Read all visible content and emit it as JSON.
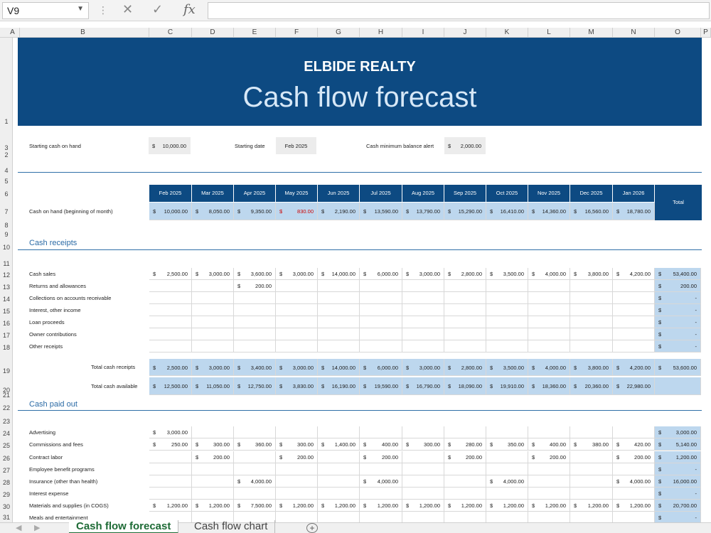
{
  "formula_bar": {
    "name_box": "V9",
    "cancel_icon": "✕",
    "enter_icon": "✓",
    "fx": "fx",
    "formula": ""
  },
  "columns": [
    "A",
    "B",
    "C",
    "D",
    "E",
    "F",
    "G",
    "H",
    "I",
    "J",
    "K",
    "L",
    "M",
    "N",
    "O",
    "P"
  ],
  "rows": [
    "1",
    "2",
    "3",
    "4",
    "5",
    "6",
    "7",
    "8",
    "9",
    "10",
    "11",
    "12",
    "13",
    "14",
    "15",
    "16",
    "17",
    "18",
    "19",
    "20",
    "21",
    "22",
    "23",
    "24",
    "25",
    "26",
    "27",
    "28",
    "29",
    "30",
    "31"
  ],
  "banner": {
    "company": "ELBIDE REALTY",
    "title": "Cash flow forecast",
    "color": "#0d4a82"
  },
  "inputs": {
    "starting_cash_label": "Starting cash on hand",
    "starting_cash_currency": "$",
    "starting_cash_value": "10,000.00",
    "starting_date_label": "Starting date",
    "starting_date_value": "Feb 2025",
    "min_balance_label": "Cash minimum balance alert",
    "min_balance_currency": "$",
    "min_balance_value": "2,000.00"
  },
  "months": [
    "Feb 2025",
    "Mar 2025",
    "Apr 2025",
    "May 2025",
    "Jun 2025",
    "Jul 2025",
    "Aug 2025",
    "Sep 2025",
    "Oct 2025",
    "Nov 2025",
    "Dec 2025",
    "Jan 2026"
  ],
  "total_label": "Total",
  "cash_on_hand": {
    "label": "Cash on hand (beginning of month)",
    "values": [
      "10,000.00",
      "8,050.00",
      "9,350.00",
      "830.00",
      "2,190.00",
      "13,590.00",
      "13,790.00",
      "15,290.00",
      "16,410.00",
      "14,360.00",
      "16,560.00",
      "18,780.00"
    ],
    "negative_index": 3
  },
  "receipts": {
    "section_title": "Cash receipts",
    "rows": [
      {
        "label": "Cash sales",
        "values": [
          "2,500.00",
          "3,000.00",
          "3,600.00",
          "3,000.00",
          "14,000.00",
          "6,000.00",
          "3,000.00",
          "2,800.00",
          "3,500.00",
          "4,000.00",
          "3,800.00",
          "4,200.00"
        ],
        "total": "53,400.00"
      },
      {
        "label": "Returns and allowances",
        "values": [
          "",
          "",
          "200.00",
          "",
          "",
          "",
          "",
          "",
          "",
          "",
          "",
          ""
        ],
        "total": "200.00"
      },
      {
        "label": "Collections on accounts receivable",
        "values": [
          "",
          "",
          "",
          "",
          "",
          "",
          "",
          "",
          "",
          "",
          "",
          ""
        ],
        "total": "-"
      },
      {
        "label": "Interest, other income",
        "values": [
          "",
          "",
          "",
          "",
          "",
          "",
          "",
          "",
          "",
          "",
          "",
          ""
        ],
        "total": "-"
      },
      {
        "label": "Loan proceeds",
        "values": [
          "",
          "",
          "",
          "",
          "",
          "",
          "",
          "",
          "",
          "",
          "",
          ""
        ],
        "total": "-"
      },
      {
        "label": "Owner contributions",
        "values": [
          "",
          "",
          "",
          "",
          "",
          "",
          "",
          "",
          "",
          "",
          "",
          ""
        ],
        "total": "-"
      },
      {
        "label": "Other receipts",
        "values": [
          "",
          "",
          "",
          "",
          "",
          "",
          "",
          "",
          "",
          "",
          "",
          ""
        ],
        "total": "-"
      }
    ],
    "total_row": {
      "label": "Total cash receipts",
      "values": [
        "2,500.00",
        "3,000.00",
        "3,400.00",
        "3,000.00",
        "14,000.00",
        "6,000.00",
        "3,000.00",
        "2,800.00",
        "3,500.00",
        "4,000.00",
        "3,800.00",
        "4,200.00"
      ],
      "total": "53,600.00"
    },
    "available_row": {
      "label": "Total cash available",
      "values": [
        "12,500.00",
        "11,050.00",
        "12,750.00",
        "3,830.00",
        "16,190.00",
        "19,590.00",
        "16,790.00",
        "18,090.00",
        "19,910.00",
        "18,360.00",
        "20,360.00",
        "22,980.00"
      ],
      "total": ""
    }
  },
  "paid_out": {
    "section_title": "Cash paid out",
    "rows": [
      {
        "label": "Advertising",
        "values": [
          "3,000.00",
          "",
          "",
          "",
          "",
          "",
          "",
          "",
          "",
          "",
          "",
          ""
        ],
        "total": "3,000.00"
      },
      {
        "label": "Commissions and fees",
        "values": [
          "250.00",
          "300.00",
          "360.00",
          "300.00",
          "1,400.00",
          "400.00",
          "300.00",
          "280.00",
          "350.00",
          "400.00",
          "380.00",
          "420.00"
        ],
        "total": "5,140.00"
      },
      {
        "label": "Contract labor",
        "values": [
          "",
          "200.00",
          "",
          "200.00",
          "",
          "200.00",
          "",
          "200.00",
          "",
          "200.00",
          "",
          "200.00"
        ],
        "total": "1,200.00"
      },
      {
        "label": "Employee benefit programs",
        "values": [
          "",
          "",
          "",
          "",
          "",
          "",
          "",
          "",
          "",
          "",
          "",
          ""
        ],
        "total": "-"
      },
      {
        "label": "Insurance (other than health)",
        "values": [
          "",
          "",
          "4,000.00",
          "",
          "",
          "4,000.00",
          "",
          "",
          "4,000.00",
          "",
          "",
          "4,000.00"
        ],
        "total": "16,000.00"
      },
      {
        "label": "Interest expense",
        "values": [
          "",
          "",
          "",
          "",
          "",
          "",
          "",
          "",
          "",
          "",
          "",
          ""
        ],
        "total": "-"
      },
      {
        "label": "Materials and supplies (in COGS)",
        "values": [
          "1,200.00",
          "1,200.00",
          "7,500.00",
          "1,200.00",
          "1,200.00",
          "1,200.00",
          "1,200.00",
          "1,200.00",
          "1,200.00",
          "1,200.00",
          "1,200.00",
          "1,200.00"
        ],
        "total": "20,700.00"
      },
      {
        "label": "Meals and entertainment",
        "values": [
          "",
          "",
          "",
          "",
          "",
          "",
          "",
          "",
          "",
          "",
          "",
          ""
        ],
        "total": "-"
      }
    ]
  },
  "currency_symbol": "$",
  "sheet_tabs": [
    {
      "label": "Cash flow forecast",
      "active": true
    },
    {
      "label": "Cash flow chart",
      "active": false
    }
  ],
  "add_sheet_icon": "+",
  "colors": {
    "header_blue": "#0d4a82",
    "light_blue": "#bdd7ee",
    "negative": "#cc0000",
    "active_tab": "#1e6b36"
  }
}
